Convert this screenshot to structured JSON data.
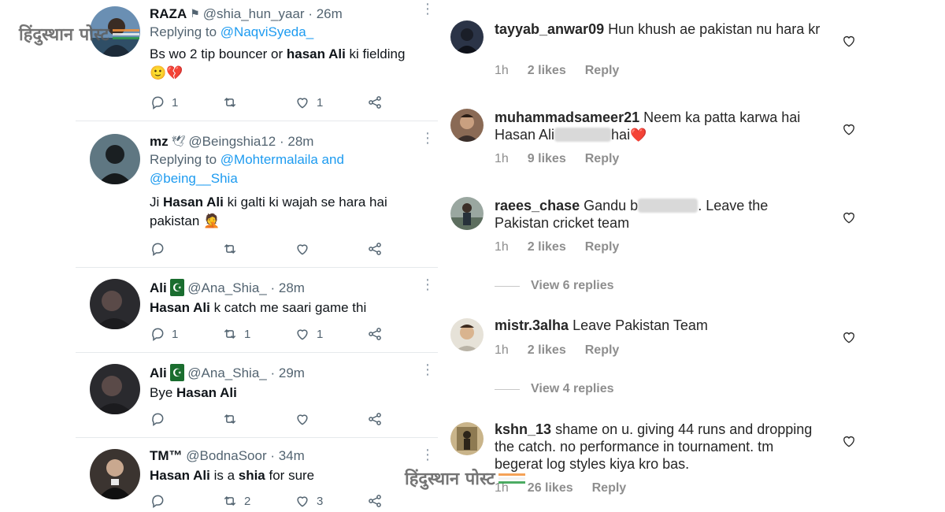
{
  "watermark": {
    "text": "हिंदुस्थान पोस्ट",
    "colors": [
      "#f4923a",
      "#ffffff",
      "#2e9e4a"
    ]
  },
  "twitter": {
    "tweets": [
      {
        "name": "RAZA",
        "badge": "⚑",
        "handle": "@shia_hun_yaar",
        "time": "· 26m",
        "replying_prefix": "Replying to",
        "replying_to": "@NaqviSyeda_",
        "text_parts": [
          "Bs wo 2 tip bouncer or ",
          "hasan Ali",
          " ki fielding"
        ],
        "emoji": "🙂💔",
        "counts": {
          "reply": "1",
          "retweet": "",
          "like": "1"
        }
      },
      {
        "name": "mz",
        "badge": "🕊",
        "handle": "@Beingshia12",
        "time": "· 28m",
        "replying_prefix": "Replying to",
        "replying_to": "@Mohtermalaila and",
        "replying_to2": "@being__Shia",
        "text_parts": [
          "Ji ",
          "Hasan Ali",
          " ki galti ki wajah se hara hai pakistan"
        ],
        "emoji": "🤦",
        "counts": {
          "reply": "",
          "retweet": "",
          "like": ""
        }
      },
      {
        "name": "Ali",
        "badge": "☪",
        "handle": "@Ana_Shia_",
        "time": "· 28m",
        "text_parts": [
          "",
          "Hasan Ali",
          " k catch me saari game thi"
        ],
        "counts": {
          "reply": "1",
          "retweet": "1",
          "like": "1"
        }
      },
      {
        "name": "Ali",
        "badge": "☪",
        "handle": "@Ana_Shia_",
        "time": "· 29m",
        "text_parts": [
          "Bye ",
          "Hasan Ali",
          ""
        ],
        "counts": {
          "reply": "",
          "retweet": "",
          "like": ""
        }
      },
      {
        "name": "TM™",
        "badge": "",
        "handle": "@BodnaSoor",
        "time": "· 34m",
        "text_parts": [
          "",
          "Hasan Ali",
          " is a ",
          "shia",
          " for sure"
        ],
        "counts": {
          "reply": "",
          "retweet": "2",
          "like": "3"
        }
      }
    ]
  },
  "instagram": {
    "comments": [
      {
        "user": "tayyab_anwar09",
        "text": "Hun khush ae pakistan nu hara kr",
        "time": "1h",
        "likes": "2 likes",
        "reply": "Reply"
      },
      {
        "user": "muhammadsameer21",
        "text_a": "Neem ka patta karwa hai Hasan Ali",
        "text_b": "hai",
        "emoji": "❤️",
        "time": "1h",
        "likes": "9 likes",
        "reply": "Reply"
      },
      {
        "user": "raees_chase",
        "text_a": "Gandu b",
        "text_b": ". Leave the Pakistan cricket team",
        "time": "1h",
        "likes": "2 likes",
        "reply": "Reply"
      },
      {
        "user": "mistr.3alha",
        "text": "Leave Pakistan Team",
        "time": "1h",
        "likes": "2 likes",
        "reply": "Reply"
      },
      {
        "user": "kshn_13",
        "text": "shame on u. giving 44 runs and dropping the catch. no performance in tournament. tm begerat log styles kiya kro bas.",
        "time": "1h",
        "likes": "26 likes",
        "reply": "Reply"
      }
    ],
    "view_replies": [
      "View 6 replies",
      "View 4 replies"
    ]
  }
}
